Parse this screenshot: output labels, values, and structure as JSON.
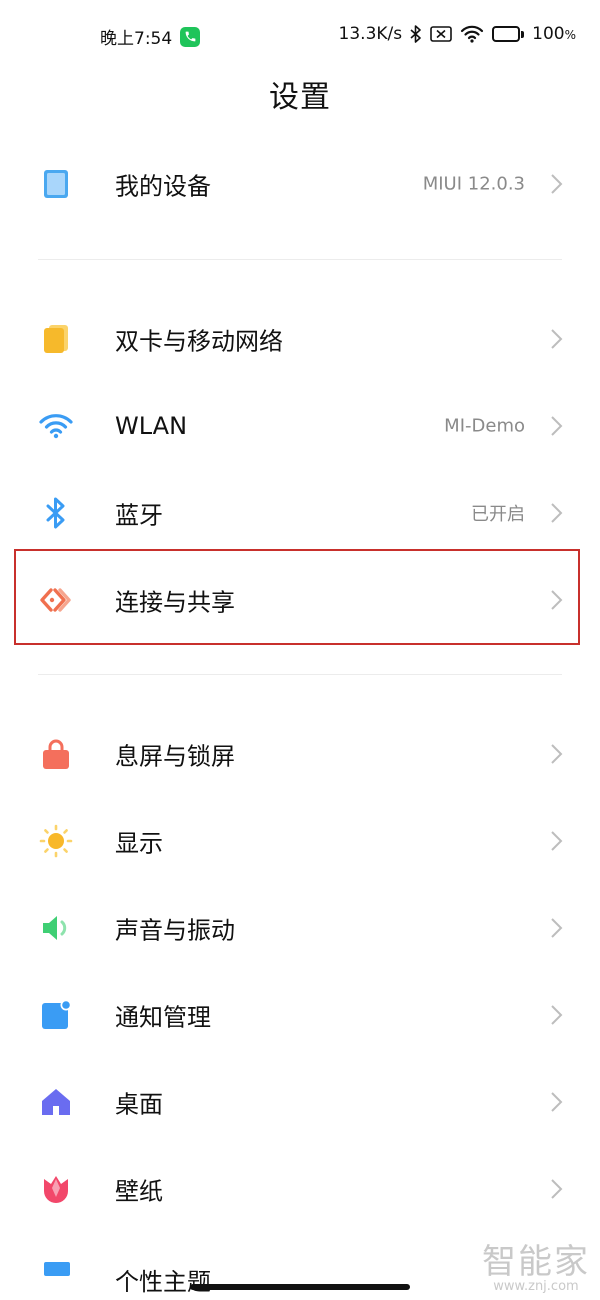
{
  "status_bar": {
    "time": "晚上7:54",
    "net_speed": "13.3K/s",
    "battery_percent": "100",
    "battery_unit": "%",
    "battery_level": 1.0,
    "call_color": "#1fc45a"
  },
  "header": {
    "title": "设置"
  },
  "sections": [
    {
      "items": [
        {
          "id": "my-device",
          "label": "我的设备",
          "value": "MIUI 12.0.3",
          "icon": "tablet-icon",
          "color": "#4aa8f0"
        }
      ]
    },
    {
      "items": [
        {
          "id": "sim-mobile",
          "label": "双卡与移动网络",
          "value": "",
          "icon": "sim-card-icon",
          "color": "#f6b92b"
        },
        {
          "id": "wlan",
          "label": "WLAN",
          "value": "MI-Demo",
          "icon": "wifi-icon",
          "color": "#3a9cf4"
        },
        {
          "id": "bluetooth",
          "label": "蓝牙",
          "value": "已开启",
          "icon": "bluetooth-icon",
          "color": "#3a9cf4"
        },
        {
          "id": "connect-share",
          "label": "连接与共享",
          "value": "",
          "icon": "share-connect-icon",
          "color": "#f0704f",
          "highlighted": true
        }
      ]
    },
    {
      "items": [
        {
          "id": "lock-screen",
          "label": "息屏与锁屏",
          "value": "",
          "icon": "lock-icon",
          "color": "#f46f5c"
        },
        {
          "id": "display",
          "label": "显示",
          "value": "",
          "icon": "sun-icon",
          "color": "#f8b82a"
        },
        {
          "id": "sound",
          "label": "声音与振动",
          "value": "",
          "icon": "speaker-icon",
          "color": "#3fcf74"
        },
        {
          "id": "notifications",
          "label": "通知管理",
          "value": "",
          "icon": "notification-icon",
          "color": "#3a9cf4"
        },
        {
          "id": "home-screen",
          "label": "桌面",
          "value": "",
          "icon": "home-icon",
          "color": "#6a6cf0"
        },
        {
          "id": "wallpaper",
          "label": "壁纸",
          "value": "",
          "icon": "tulip-icon",
          "color": "#f2476a"
        },
        {
          "id": "themes",
          "label": "个性主题",
          "value": "",
          "icon": "theme-icon",
          "color": "#3a9cf4",
          "partial": true
        }
      ]
    }
  ],
  "highlight_color": "#c8302c",
  "watermark": {
    "text": "智能家",
    "url": "www.znj.com"
  }
}
